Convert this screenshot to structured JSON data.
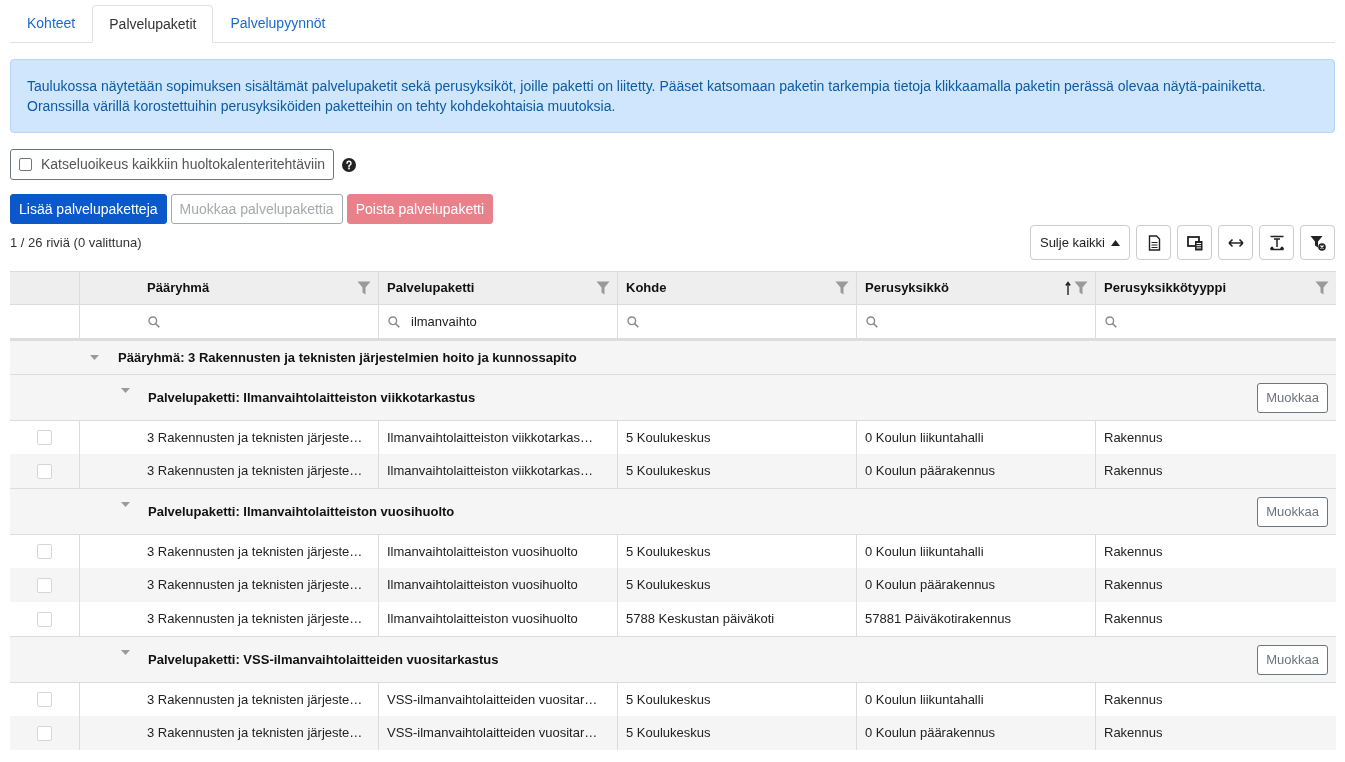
{
  "tabs": [
    {
      "label": "Kohteet",
      "selected": false
    },
    {
      "label": "Palvelupaketit",
      "selected": true
    },
    {
      "label": "Palvelupyynnöt",
      "selected": false
    }
  ],
  "info": {
    "lines": [
      "Taulukossa näytetään sopimuksen sisältämät palvelupaketit sekä perusyksiköt, joille paketti on liitetty. Pääset katsomaan paketin tarkempia tietoja klikkaamalla paketin perässä olevaa näytä-painiketta.",
      "Oranssilla värillä korostettuihin perusyksiköiden paketteihin on tehty kohdekohtaisia muutoksia."
    ]
  },
  "view_permission": {
    "label": "Katseluoikeus kaikkiin huoltokalenteritehtäviin",
    "checked": false
  },
  "actions": [
    {
      "label": "Lisää palvelupaketteja",
      "kind": "primary",
      "disabled": false
    },
    {
      "label": "Muokkaa palvelupakettia",
      "kind": "secondary",
      "disabled": true
    },
    {
      "label": "Poista palvelupaketti",
      "kind": "danger",
      "disabled": true
    }
  ],
  "row_count": "1 / 26 riviä (0 valittuna)",
  "toolbar": {
    "collapse_button": "Sulje kaikki"
  },
  "table": {
    "columns": [
      {
        "label": "Pääryhmä",
        "sorted": false
      },
      {
        "label": "Palvelupaketti",
        "sorted": false,
        "filter_value": "ilmanvaihto"
      },
      {
        "label": "Kohde",
        "sorted": false
      },
      {
        "label": "Perusyksikkö",
        "sorted": true
      },
      {
        "label": "Perusyksikkötyyppi",
        "sorted": false
      }
    ],
    "groups": [
      {
        "label": "Pääryhmä: 3 Rakennusten ja teknisten järjestelmien hoito ja kunnossapito",
        "expanded": true,
        "children": [
          {
            "label": "Palvelupaketti: Ilmanvaihtolaitteiston viikkotarkastus",
            "expanded": true,
            "action": "Muokkaa",
            "rows": [
              {
                "checked": false,
                "cells": [
                  "3 Rakennusten ja teknisten järjeste…",
                  "Ilmanvaihtolaitteiston viikkotarkas…",
                  "5 Koulukeskus",
                  "0 Koulun liikuntahalli",
                  "Rakennus"
                ]
              },
              {
                "checked": false,
                "cells": [
                  "3 Rakennusten ja teknisten järjeste…",
                  "Ilmanvaihtolaitteiston viikkotarkas…",
                  "5 Koulukeskus",
                  "0 Koulun päärakennus",
                  "Rakennus"
                ]
              }
            ]
          },
          {
            "label": "Palvelupaketti: Ilmanvaihtolaitteiston vuosihuolto",
            "expanded": true,
            "action": "Muokkaa",
            "rows": [
              {
                "checked": false,
                "cells": [
                  "3 Rakennusten ja teknisten järjeste…",
                  "Ilmanvaihtolaitteiston vuosihuolto",
                  "5 Koulukeskus",
                  "0 Koulun liikuntahalli",
                  "Rakennus"
                ]
              },
              {
                "checked": false,
                "cells": [
                  "3 Rakennusten ja teknisten järjeste…",
                  "Ilmanvaihtolaitteiston vuosihuolto",
                  "5 Koulukeskus",
                  "0 Koulun päärakennus",
                  "Rakennus"
                ]
              },
              {
                "checked": false,
                "cells": [
                  "3 Rakennusten ja teknisten järjeste…",
                  "Ilmanvaihtolaitteiston vuosihuolto",
                  "5788 Keskustan päiväkoti",
                  "57881 Päiväkotirakennus",
                  "Rakennus"
                ]
              }
            ]
          },
          {
            "label": "Palvelupaketti: VSS-ilmanvaihtolaitteiden vuositarkastus",
            "expanded": true,
            "action": "Muokkaa",
            "rows": [
              {
                "checked": false,
                "cells": [
                  "3 Rakennusten ja teknisten järjeste…",
                  "VSS-ilmanvaihtolaitteiden vuositar…",
                  "5 Koulukeskus",
                  "0 Koulun liikuntahalli",
                  "Rakennus"
                ]
              },
              {
                "checked": false,
                "cells": [
                  "3 Rakennusten ja teknisten järjeste…",
                  "VSS-ilmanvaihtolaitteiden vuositar…",
                  "5 Koulukeskus",
                  "0 Koulun päärakennus",
                  "Rakennus"
                ]
              }
            ]
          }
        ]
      }
    ]
  }
}
